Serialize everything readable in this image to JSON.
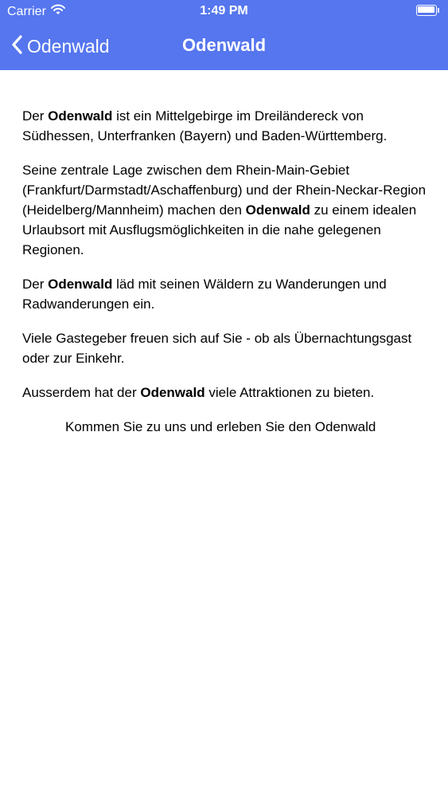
{
  "status_bar": {
    "carrier": "Carrier",
    "time": "1:49 PM",
    "battery_level_percent": 100
  },
  "nav": {
    "back_label": "Odenwald",
    "title": "Odenwald"
  },
  "content": {
    "p1": {
      "before": "Der ",
      "bold": "Odenwald",
      "after": " ist ein Mittelgebirge im Dreiländereck von Südhessen, Unterfranken (Bayern) und Baden-Württemberg."
    },
    "p2": {
      "before": "Seine zentrale Lage zwischen dem Rhein-Main-Gebiet (Frankfurt/Darmstadt/Aschaffenburg) und der Rhein-Neckar-Region (Heidelberg/Mannheim) machen den ",
      "bold": "Odenwald",
      "after": " zu einem idealen Urlaubsort mit Ausflugsmöglichkeiten in die nahe gelegenen Regionen."
    },
    "p3": {
      "before": "Der ",
      "bold": "Odenwald",
      "after": " läd mit seinen Wäldern zu Wanderungen und Radwanderungen ein."
    },
    "p4": {
      "text": "Viele Gastegeber freuen sich auf Sie - ob als Übernachtungsgast oder zur Einkehr."
    },
    "p5": {
      "before": "Ausserdem hat der ",
      "bold": "Odenwald",
      "after": " viele Attraktionen zu bieten."
    },
    "closing": "Kommen Sie zu uns und erleben Sie den Odenwald"
  },
  "colors": {
    "header_background": "#5576ee",
    "header_text": "#ffffff",
    "body_background": "#ffffff",
    "body_text": "#000000"
  }
}
